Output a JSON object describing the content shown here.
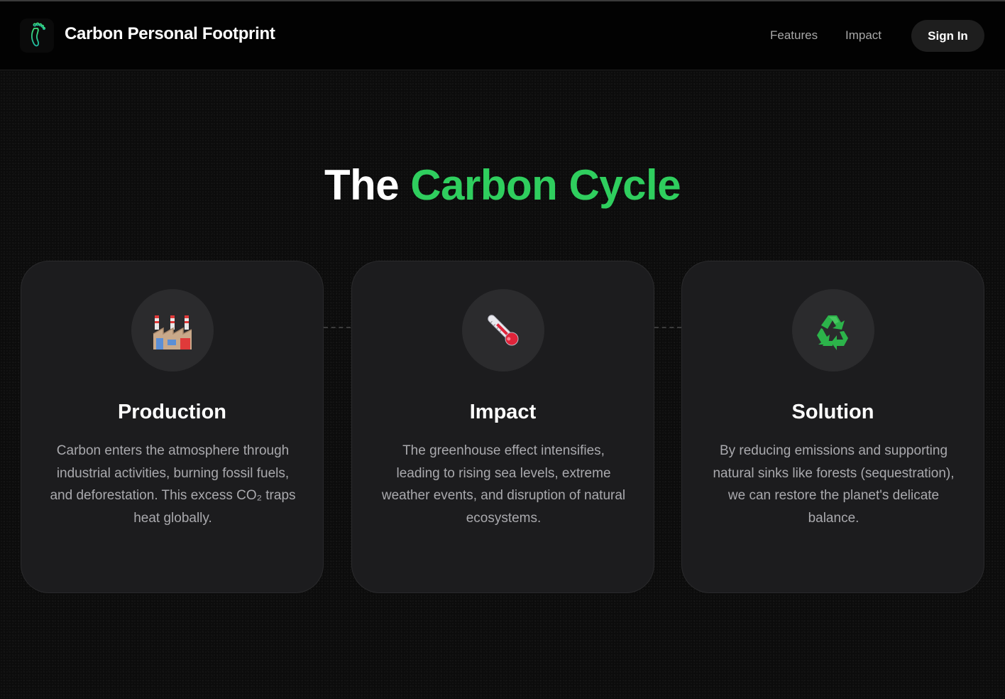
{
  "header": {
    "brand": "Carbon Personal Footprint",
    "logo_icon": "footprint-icon",
    "nav": {
      "features": "Features",
      "impact": "Impact"
    },
    "sign_in": "Sign In"
  },
  "hero": {
    "title_prefix": "The ",
    "title_accent": "Carbon Cycle",
    "accent_color": "#2fce5e"
  },
  "cards": [
    {
      "icon": "factory-icon",
      "title": "Production",
      "text": "Carbon enters the atmosphere through industrial activities, burning fossil fuels, and deforestation. This excess CO₂ traps heat globally."
    },
    {
      "icon": "thermometer-icon",
      "title": "Impact",
      "text": "The greenhouse effect intensifies, leading to rising sea levels, extreme weather events, and disruption of natural ecosystems."
    },
    {
      "icon": "recycle-icon",
      "title": "Solution",
      "text": "By reducing emissions and supporting natural sinks like forests (sequestration), we can restore the planet's delicate balance."
    }
  ]
}
